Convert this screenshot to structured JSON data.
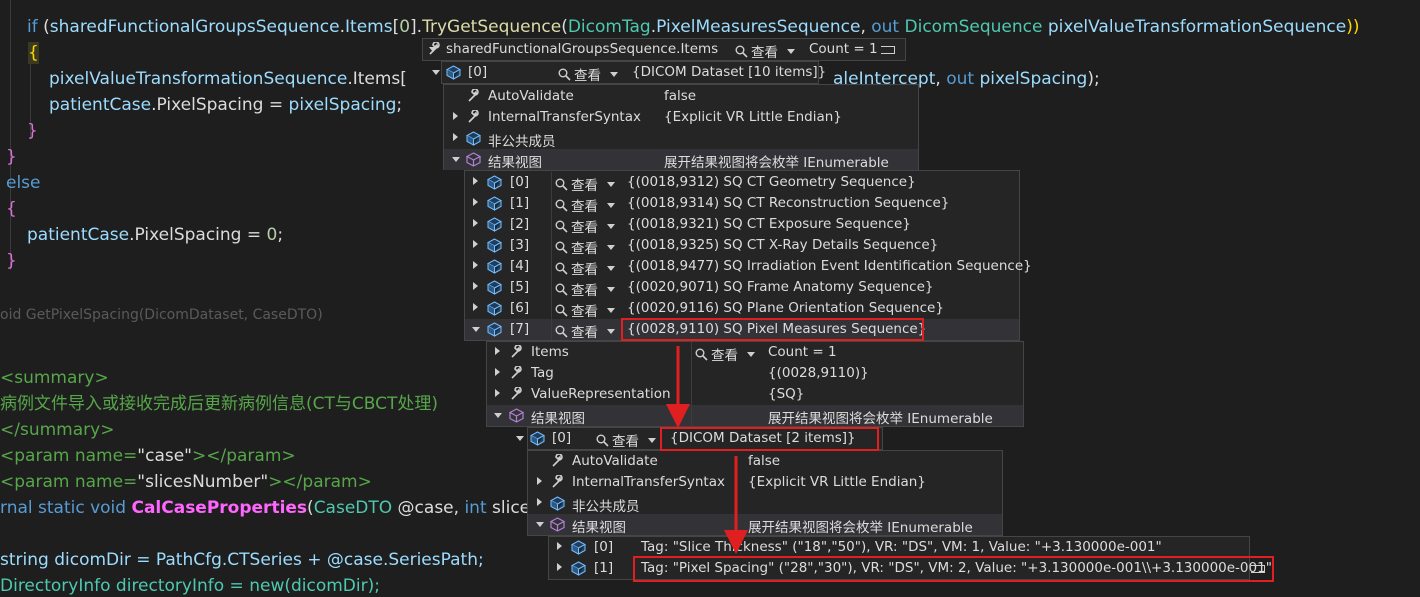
{
  "code": {
    "line1": {
      "if": "if",
      "p1": " (",
      "obj": "sharedFunctionalGroupsSequence",
      "p2": ".",
      "items": "Items",
      "p3": "[",
      "idx": "0",
      "p4": "].",
      "call": "TryGetSequence",
      "p5": "(",
      "ty": "DicomTag",
      "p6": ".",
      "tag": "PixelMeasuresSequence",
      "p7": ", ",
      "out": "out",
      "sp": " ",
      "ty2": "DicomSequence",
      "sp2": " ",
      "var": "pixelValueTransformationSequence",
      "p8": "))"
    },
    "line2": "{",
    "line3a": "pixelValueTransformationSequence",
    "line3b": ".Items[",
    "line3c": "aleIntercept",
    "line3d": ", ",
    "line3e": "out",
    "line3f": " pixelSpacing",
    "line3g": ");",
    "line4a": "patientCase",
    "line4b": ".PixelSpacing = ",
    "line4c": "pixelSpacing",
    "line4d": ";",
    "line5": "}",
    "line6": "}",
    "line7": "else",
    "line8": "{",
    "line9a": "patientCase",
    "line9b": ".PixelSpacing = ",
    "line9c": "0",
    "line9d": ";",
    "line10": "}",
    "line11": "oid GetPixelSpacing(DicomDataset, CaseDTO)",
    "line12": "<summary>",
    "line13": "病例文件导入或接收完成后更新病例信息(CT与CBCT处理)",
    "line14": "</summary>",
    "line15a": "<param name=",
    "line15b": "\"case\"",
    "line15c": "></param>",
    "line16a": "<param name=",
    "line16b": "\"slicesNumber\"",
    "line16c": "></param>",
    "line17a": "rnal static void ",
    "line17b": "CalCaseProperties",
    "line17c": "(",
    "line17d": "CaseDTO",
    "line17e": " @case, ",
    "line17f": "int",
    "line17g": " slice",
    "line18": "string dicomDir = PathCfg.CTSeries + @case.SeriesPath;",
    "line19": "DirectoryInfo directoryInfo = new(dicomDir);"
  },
  "view_label": "查看",
  "panel1": {
    "name": "sharedFunctionalGroupsSequence.Items",
    "value": "Count = 1"
  },
  "panel2": [
    {
      "name": "[0]",
      "value": "{DICOM Dataset [10 items]}"
    }
  ],
  "panel3": [
    {
      "name": "AutoValidate",
      "value": "false"
    },
    {
      "name": "InternalTransferSyntax",
      "value": "{Explicit VR Little Endian}"
    },
    {
      "name": "非公共成员",
      "value": ""
    },
    {
      "name": "结果视图",
      "value": "展开结果视图将会枚举 IEnumerable"
    }
  ],
  "panel4": [
    {
      "name": "[0]",
      "value": "{(0018,9312) SQ CT Geometry Sequence}"
    },
    {
      "name": "[1]",
      "value": "{(0018,9314) SQ CT Reconstruction Sequence}"
    },
    {
      "name": "[2]",
      "value": "{(0018,9321) SQ CT Exposure Sequence}"
    },
    {
      "name": "[3]",
      "value": "{(0018,9325) SQ CT X-Ray Details Sequence}"
    },
    {
      "name": "[4]",
      "value": "{(0018,9477) SQ Irradiation Event Identification Sequence}"
    },
    {
      "name": "[5]",
      "value": "{(0020,9071) SQ Frame Anatomy Sequence}"
    },
    {
      "name": "[6]",
      "value": "{(0020,9116) SQ Plane Orientation Sequence}"
    },
    {
      "name": "[7]",
      "value": "{(0028,9110) SQ Pixel Measures Sequence}"
    }
  ],
  "panel5": [
    {
      "name": "Items",
      "value": "Count = 1"
    },
    {
      "name": "Tag",
      "value": "{(0028,9110)}"
    },
    {
      "name": "ValueRepresentation",
      "value": "{SQ}"
    },
    {
      "name": "结果视图",
      "value": "展开结果视图将会枚举 IEnumerable"
    }
  ],
  "panel6": [
    {
      "name": "[0]",
      "value": "{DICOM Dataset [2 items]}"
    }
  ],
  "panel7": [
    {
      "name": "AutoValidate",
      "value": "false"
    },
    {
      "name": "InternalTransferSyntax",
      "value": "{Explicit VR Little Endian}"
    },
    {
      "name": "非公共成员",
      "value": ""
    },
    {
      "name": "结果视图",
      "value": "展开结果视图将会枚举 IEnumerable"
    }
  ],
  "panel8": [
    {
      "name": "[0]",
      "value": "Tag: \"Slice Thickness\" (\"18\",\"50\"), VR: \"DS\", VM: 1, Value: \"+3.130000e-001\""
    },
    {
      "name": "[1]",
      "value": "Tag: \"Pixel Spacing\" (\"28\",\"30\"), VR: \"DS\", VM: 2, Value: \"+3.130000e-001\\\\+3.130000e-001\""
    }
  ],
  "colors": {
    "highlight": "#e02020",
    "keyword": "#569cd6",
    "type": "#4ec9b0",
    "method": "#dcdcaa",
    "variable": "#9cdcfe",
    "string": "#d69d85",
    "comment": "#57a64a",
    "panel_bg": "#252526"
  }
}
